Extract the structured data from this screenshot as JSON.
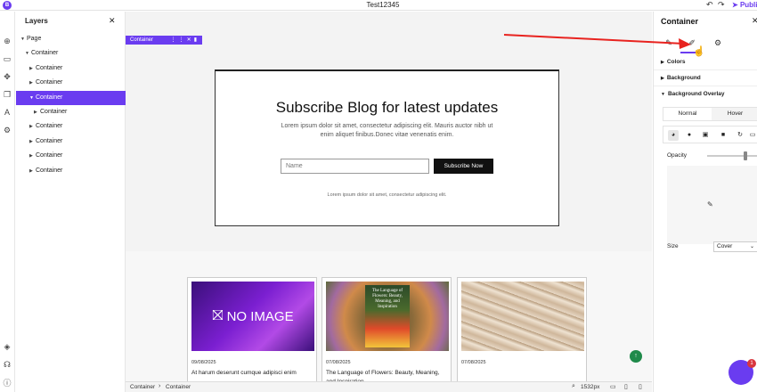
{
  "app": {
    "logo": "B",
    "title": "Test12345",
    "publish_label": "Publis"
  },
  "icons": {
    "undo": "undo-icon",
    "redo": "redo-icon",
    "add": "plus-circle-icon",
    "section": "rectangle-icon",
    "components": "components-icon",
    "pages": "pages-icon",
    "text": "text-icon",
    "settings": "gear-icon",
    "layers": "layers-icon",
    "help": "headset-icon",
    "info": "info-icon"
  },
  "layers_panel": {
    "title": "Layers",
    "items": [
      {
        "label": "Page",
        "depth": 0,
        "expanded": true
      },
      {
        "label": "Container",
        "depth": 1,
        "expanded": true
      },
      {
        "label": "Container",
        "depth": 2,
        "expanded": false
      },
      {
        "label": "Container",
        "depth": 2,
        "expanded": false
      },
      {
        "label": "Container",
        "depth": 2,
        "expanded": true,
        "selected": true
      },
      {
        "label": "Container",
        "depth": 3,
        "expanded": false
      },
      {
        "label": "Container",
        "depth": 2,
        "expanded": false
      },
      {
        "label": "Container",
        "depth": 2,
        "expanded": false
      },
      {
        "label": "Container",
        "depth": 2,
        "expanded": false
      },
      {
        "label": "Container",
        "depth": 2,
        "expanded": false
      }
    ]
  },
  "canvas": {
    "container_tag": "Container",
    "subscribe": {
      "title": "Subscribe Blog for latest updates",
      "desc": "Lorem ipsum dolor sit amet, consectetur adipiscing elit. Mauris auctor nibh ut enim aliquet finibus.Donec vitae venenatis enim.",
      "input_placeholder": "Name",
      "button_label": "Subscribe Now",
      "footer": "Lorem ipsum dolor sit amet, consectetur adipiscing elit."
    },
    "cards": [
      {
        "image_text": "NO IMAGE",
        "date": "09/08/2025",
        "title": "At harum deserunt cumque adipisci enim"
      },
      {
        "image_text": "The Language of Flowers: Beauty, Meaning, and Inspiration",
        "date": "07/08/2025",
        "title": "The Language of Flowers: Beauty, Meaning, and Inspiration"
      },
      {
        "image_text": "",
        "date": "07/08/2025",
        "title": ""
      }
    ]
  },
  "right_panel": {
    "title": "Container",
    "accordions": [
      "Colors",
      "Background",
      "Background Overlay"
    ],
    "tabs": [
      "Normal",
      "Hover"
    ],
    "opacity_label": "Opacity",
    "opacity_value": 0.85,
    "size_label": "Size",
    "size_value": "Cover"
  },
  "bottom_bar": {
    "crumbs": [
      "Container",
      "Container"
    ],
    "zoom": "1532px"
  },
  "chat_badge": "1",
  "colors": {
    "accent": "#6a3cf0",
    "arrow": "#e8231f",
    "fab": "#1f8a4a"
  }
}
